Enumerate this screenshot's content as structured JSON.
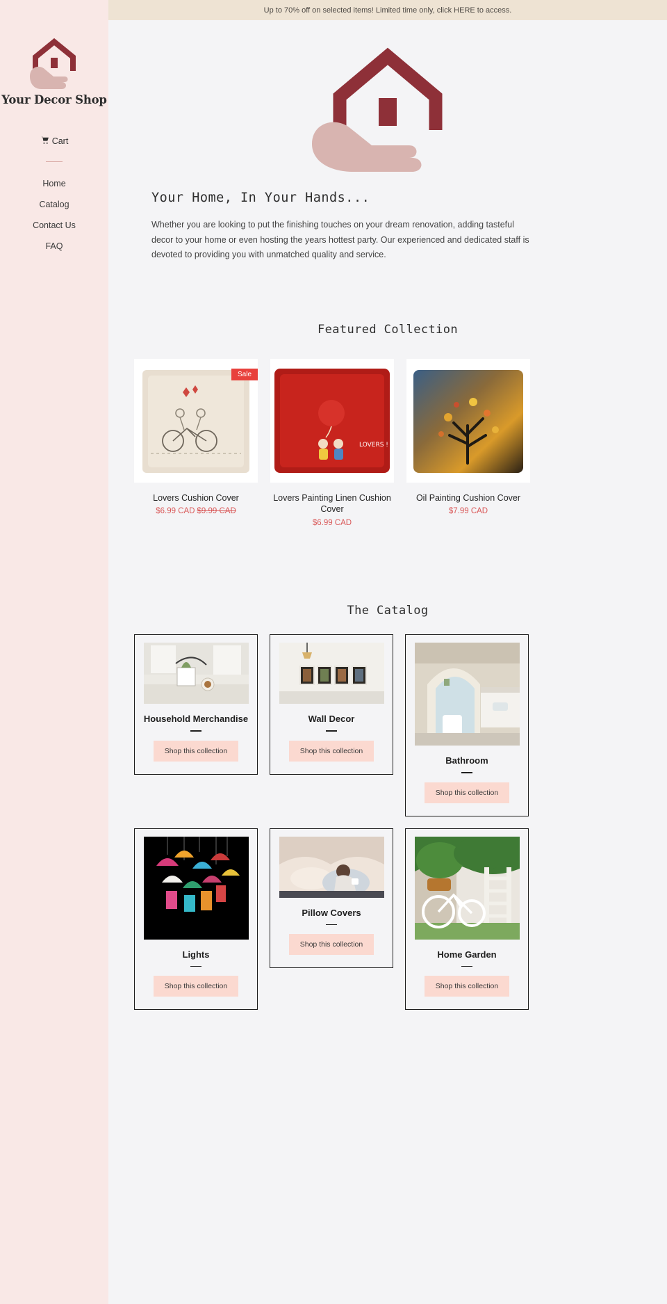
{
  "announcement": {
    "text": "Up to 70% off on selected items! Limited time only, click HERE to access.",
    "bg": "#eee3d3"
  },
  "sidebar": {
    "brand_name": "Your Decor Shop",
    "logo_icon": "house-in-hand-logo",
    "cart": {
      "label": "Cart",
      "icon": "shopping-cart-icon"
    },
    "nav": [
      {
        "label": "Home"
      },
      {
        "label": "Catalog"
      },
      {
        "label": "Contact Us"
      },
      {
        "label": "FAQ"
      }
    ],
    "bg": "#f9e8e6"
  },
  "hero": {
    "logo_icon": "house-in-hand-logo-large",
    "title": "Your Home, In Your Hands...",
    "body": "Whether you are looking to put the finishing touches on your dream renovation, adding tasteful decor to your home or even hosting the years hottest party. Our experienced and dedicated staff is devoted to providing you with unmatched quality and service."
  },
  "featured": {
    "heading": "Featured Collection",
    "products": [
      {
        "title": "Lovers Cushion Cover",
        "price": "$6.99 CAD",
        "compare_at_price": "$9.99 CAD",
        "badge": "Sale",
        "image_alt": "beige cushion with couple on tandem bicycle drawing"
      },
      {
        "title": "Lovers Painting Linen Cushion Cover",
        "price": "$6.99 CAD",
        "compare_at_price": "",
        "badge": "",
        "image_alt": "red cushion with kids holding balloons and LOVERS ! text"
      },
      {
        "title": "Oil Painting Cushion Cover",
        "price": "$7.99 CAD",
        "compare_at_price": "",
        "badge": "",
        "image_alt": "dark cushion with colorful oil painted tree of life"
      }
    ],
    "accent_price_color": "#d95858",
    "badge_color": "#e8413c"
  },
  "catalog": {
    "heading": "The Catalog",
    "button_label": "Shop this collection",
    "collections": [
      {
        "name": "Household Merchandise",
        "image_alt": "wire basket with plant and coffee cup on white table",
        "tall": false
      },
      {
        "name": "Wall Decor",
        "image_alt": "four framed pictures on white wall with pendant lamp",
        "tall": false
      },
      {
        "name": "Bathroom",
        "image_alt": "bright bathroom with arched mirror and stone wall",
        "tall": true
      },
      {
        "name": "Lights",
        "image_alt": "colorful hanging pendant lamps on black background",
        "tall": true
      },
      {
        "name": "Pillow Covers",
        "image_alt": "woman resting on bed with pillows holding mug",
        "tall": false
      },
      {
        "name": "Home Garden",
        "image_alt": "white bicycle and ladder with green plants by house",
        "tall": true
      }
    ],
    "button_bg": "#fbd9d0"
  }
}
